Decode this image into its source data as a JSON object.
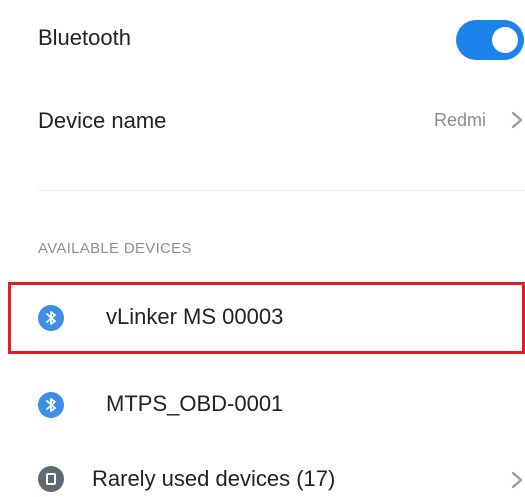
{
  "bluetooth": {
    "label": "Bluetooth",
    "enabled": true,
    "accent": "#1d83ea"
  },
  "device_name": {
    "label": "Device name",
    "value": "Redmi"
  },
  "available": {
    "header": "AVAILABLE DEVICES",
    "devices": [
      {
        "name": "vLinker MS 00003",
        "icon": "bluetooth-icon",
        "highlighted": true,
        "highlight_color": "#e01e2a"
      },
      {
        "name": "MTPS_OBD-0001",
        "icon": "bluetooth-icon",
        "highlighted": false
      }
    ],
    "rarely_used": {
      "label": "Rarely used devices (17)",
      "icon": "device-list-icon"
    }
  }
}
